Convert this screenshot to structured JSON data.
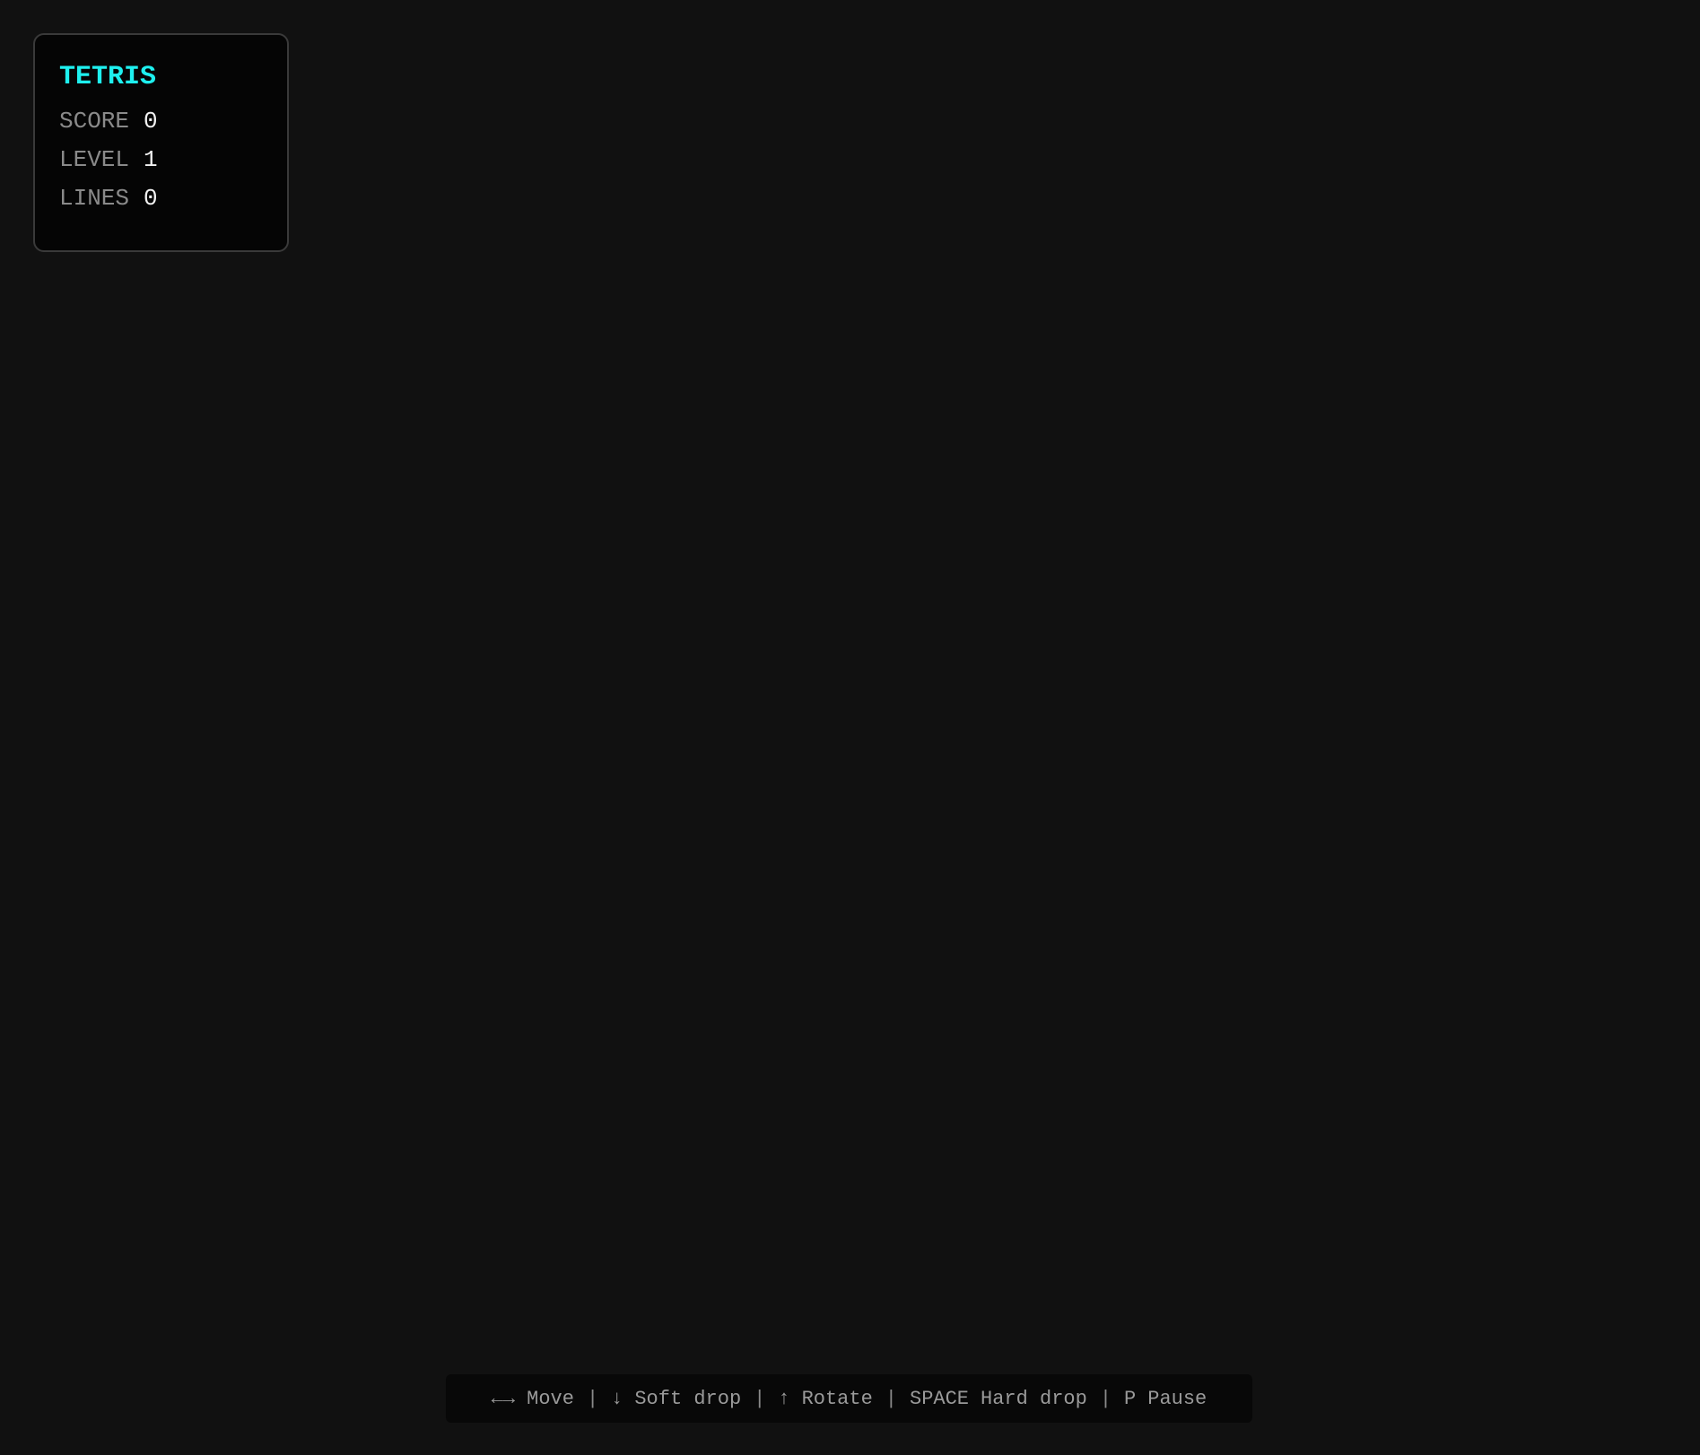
{
  "panel": {
    "title": "TETRIS",
    "stats": [
      {
        "label": "SCORE",
        "value": "0"
      },
      {
        "label": "LEVEL",
        "value": "1"
      },
      {
        "label": "LINES",
        "value": "0"
      }
    ]
  },
  "controls": [
    {
      "key": "←→",
      "action": "Move"
    },
    {
      "key": "↓",
      "action": "Soft drop"
    },
    {
      "key": "↑",
      "action": "Rotate"
    },
    {
      "key": "SPACE",
      "action": "Hard drop"
    },
    {
      "key": "P",
      "action": "Pause"
    }
  ],
  "separator": "|",
  "colors": {
    "background": "#111111",
    "title_accent": "#1ef0ef",
    "label": "#8a8a8a",
    "value": "#f2f2f2"
  }
}
